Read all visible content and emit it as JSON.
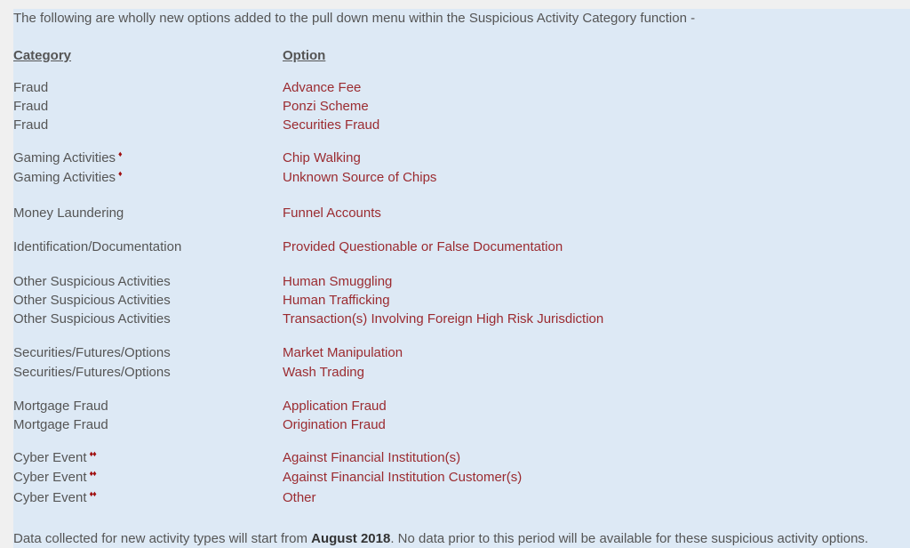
{
  "intro": "The following are wholly new options added to the pull down menu within the Suspicious Activity Category function -",
  "headers": {
    "category": "Category",
    "option": "Option"
  },
  "rows": [
    {
      "category": "Fraud",
      "mark": "",
      "option": "Advance Fee"
    },
    {
      "category": "Fraud",
      "mark": "",
      "option": "Ponzi Scheme"
    },
    {
      "category": "Fraud",
      "mark": "",
      "option": "Securities Fraud"
    },
    {
      "category": "Gaming Activities",
      "mark": "♦",
      "option": "Chip Walking"
    },
    {
      "category": "Gaming Activities",
      "mark": "♦",
      "option": "Unknown Source of Chips"
    },
    {
      "category": "Money Laundering",
      "mark": "",
      "option": "Funnel Accounts"
    },
    {
      "category": "Identification/Documentation",
      "mark": "",
      "option": "Provided Questionable or False Documentation"
    },
    {
      "category": "Other Suspicious Activities",
      "mark": "",
      "option": "Human Smuggling"
    },
    {
      "category": "Other Suspicious Activities",
      "mark": "",
      "option": "Human Trafficking"
    },
    {
      "category": "Other Suspicious Activities",
      "mark": "",
      "option": "Transaction(s) Involving Foreign High Risk Jurisdiction"
    },
    {
      "category": "Securities/Futures/Options",
      "mark": "",
      "option": "Market Manipulation"
    },
    {
      "category": "Securities/Futures/Options",
      "mark": "",
      "option": "Wash Trading"
    },
    {
      "category": "Mortgage Fraud",
      "mark": "",
      "option": "Application Fraud"
    },
    {
      "category": "Mortgage Fraud",
      "mark": "",
      "option": "Origination Fraud"
    },
    {
      "category": "Cyber Event",
      "mark": "♦♦",
      "option": "Against Financial Institution(s)"
    },
    {
      "category": "Cyber Event",
      "mark": "♦♦",
      "option": "Against Financial Institution Customer(s)"
    },
    {
      "category": "Cyber Event",
      "mark": "♦♦",
      "option": "Other"
    }
  ],
  "footer": {
    "before": "Data collected for new activity types will start from ",
    "bold": "August 2018",
    "after": ". No data prior to this period will be available for these suspicious activity options."
  },
  "colors": {
    "option_text": "#9b2b30",
    "panel_bg": "#dde9f5",
    "body_text": "#555555",
    "marker": "#a01010"
  }
}
